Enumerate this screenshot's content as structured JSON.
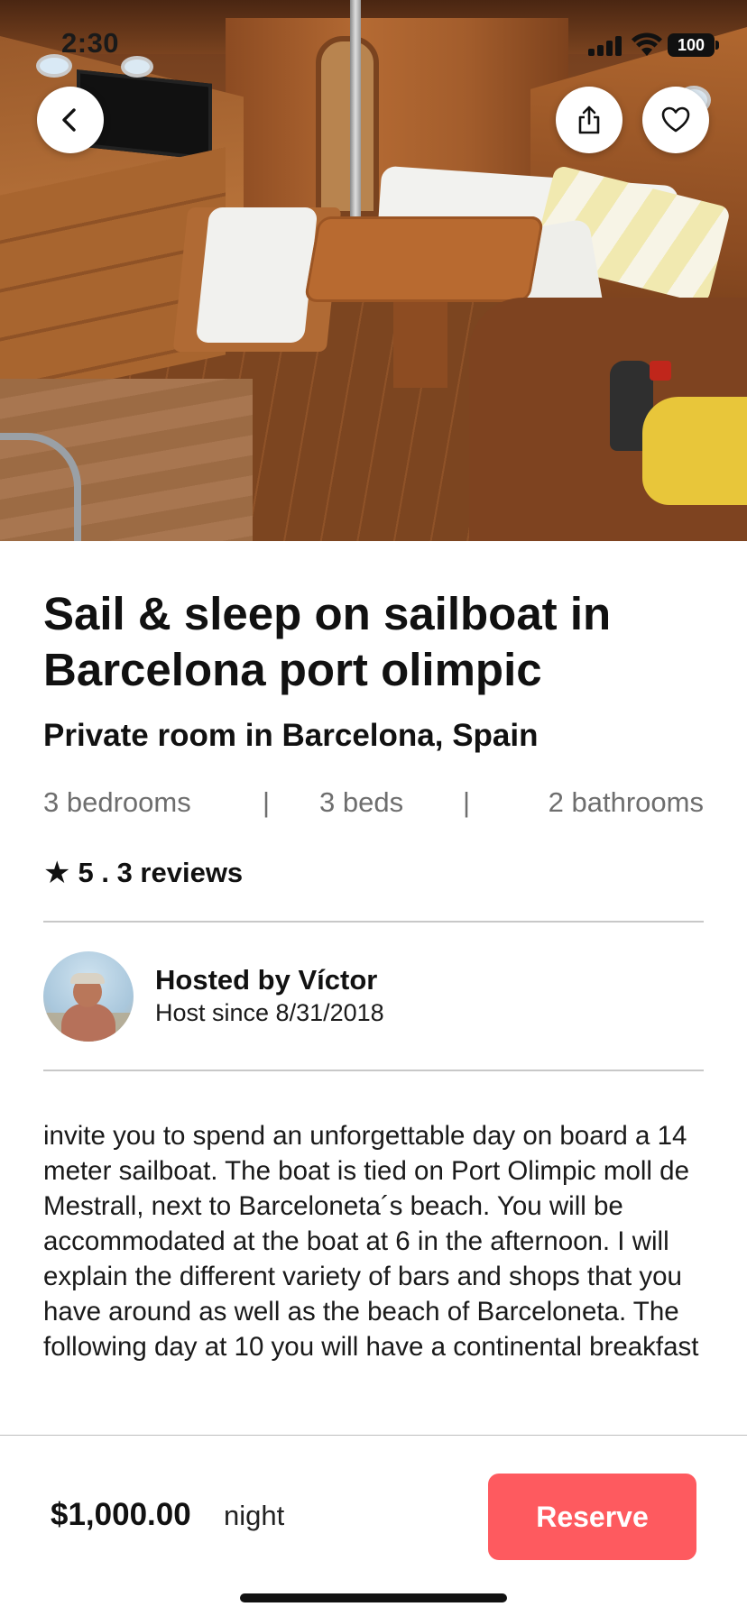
{
  "status_bar": {
    "time": "2:30",
    "battery": "100"
  },
  "hero": {
    "photo_alt": "Sailboat cabin interior with wooden table and white cushioned seating"
  },
  "nav": {
    "back_icon": "chevron-left-icon",
    "share_icon": "share-icon",
    "favorite_icon": "heart-icon"
  },
  "listing": {
    "title": "Sail & sleep on sailboat in Barcelona port olimpic",
    "subtitle": "Private room in Barcelona, Spain",
    "stats": {
      "bedrooms": "3 bedrooms",
      "separator": "|",
      "beds": "3 beds",
      "bathrooms": "2 bathrooms"
    },
    "rating": {
      "star": "★",
      "text": "5 . 3 reviews"
    },
    "host": {
      "name": "Hosted by Víctor",
      "since": "Host since 8/31/2018"
    },
    "description": "invite you to spend an unforgettable day on board a 14 meter sailboat. The boat is tied on Port Olimpic moll de Mestrall, next to Barceloneta´s beach. You will be accommodated at the boat at 6 in the afternoon. I will explain the different variety of bars and shops that you have around as well as the beach of Barceloneta. The following day at 10 you will have a continental breakfast"
  },
  "footer": {
    "price": "$1,000.00",
    "per": "night",
    "reserve_label": "Reserve"
  },
  "colors": {
    "accent": "#fe5a5f",
    "divider": "#c8c8c8",
    "muted_text": "#6e6e6e"
  }
}
